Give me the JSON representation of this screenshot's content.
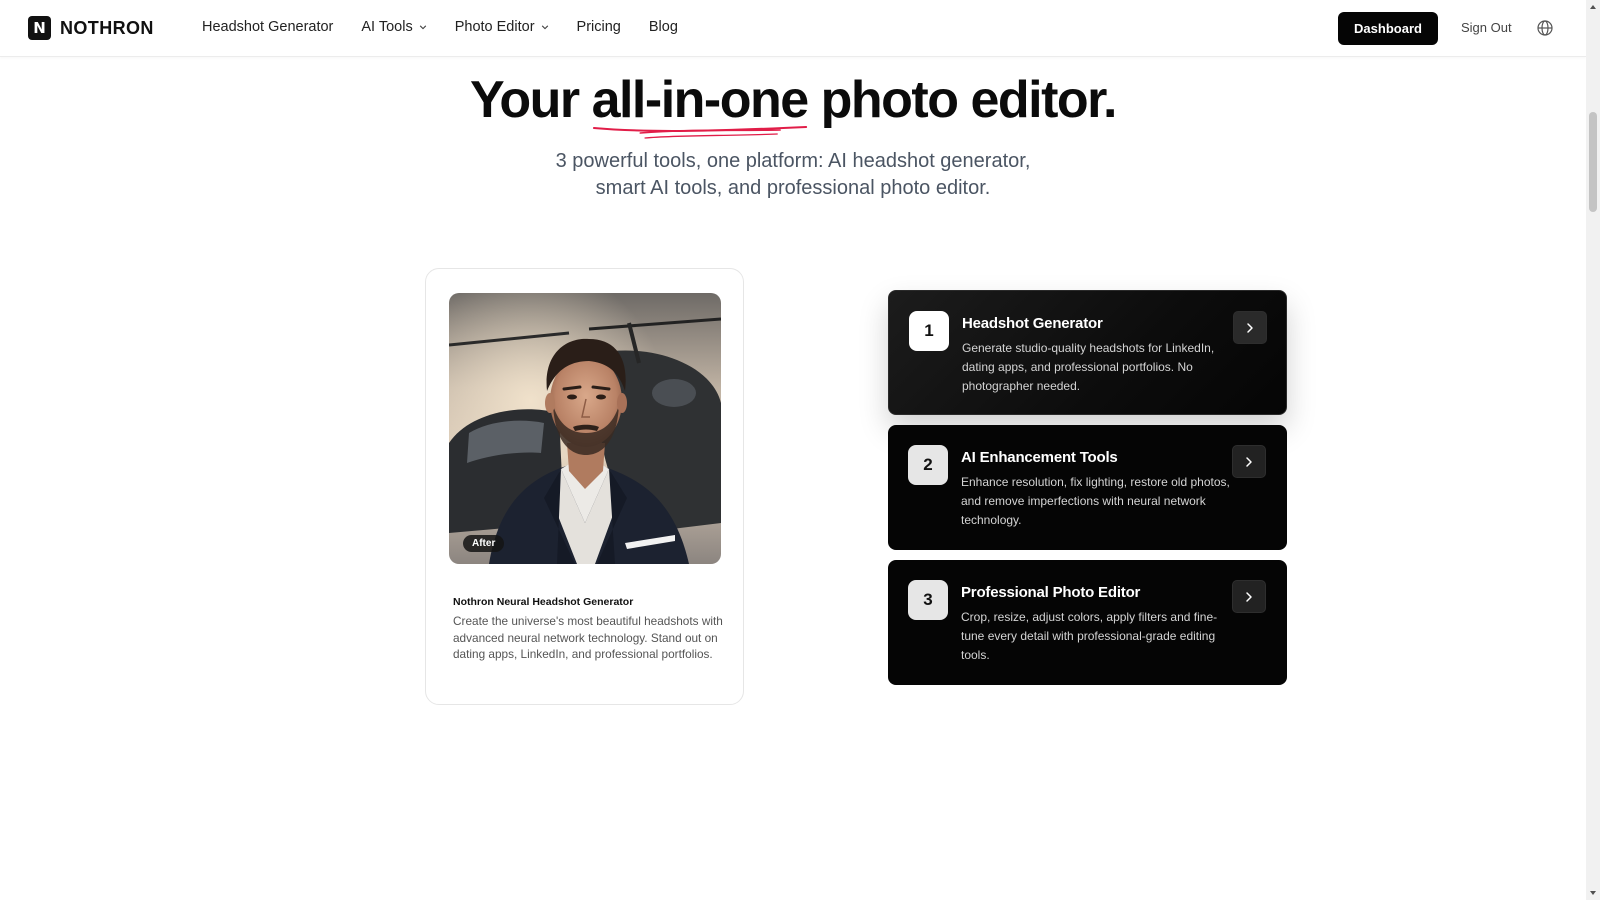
{
  "nav": {
    "logo_letter": "N",
    "logo_text": "NOTHRON",
    "links": [
      {
        "label": "Headshot Generator"
      },
      {
        "label": "AI Tools"
      },
      {
        "label": "Photo Editor"
      },
      {
        "label": "Pricing"
      },
      {
        "label": "Blog"
      }
    ],
    "dashboard_label": "Dashboard",
    "signout_label": "Sign Out"
  },
  "hero": {
    "title_pre": "Your ",
    "title_highlight": "all-in-one",
    "title_post": " photo editor.",
    "subtitle_line1": "3 powerful tools, one platform: AI headshot generator,",
    "subtitle_line2": "smart AI tools, and professional photo editor.",
    "highlight_color": "#e11d48"
  },
  "showcase": {
    "badge": "After",
    "title": "Nothron Neural Headshot Generator",
    "description": "Create the universe's most beautiful headshots with advanced neural network technology. Stand out on dating apps, LinkedIn, and professional portfolios."
  },
  "tools": [
    {
      "number": "1",
      "title": "Headshot Generator",
      "description": "Generate studio-quality headshots for LinkedIn, dating apps, and professional portfolios. No photographer needed."
    },
    {
      "number": "2",
      "title": "AI Enhancement Tools",
      "description": "Enhance resolution, fix lighting, restore old photos, and remove imperfections with neural network technology."
    },
    {
      "number": "3",
      "title": "Professional Photo Editor",
      "description": "Crop, resize, adjust colors, apply filters and fine-tune every detail with professional-grade editing tools."
    }
  ]
}
